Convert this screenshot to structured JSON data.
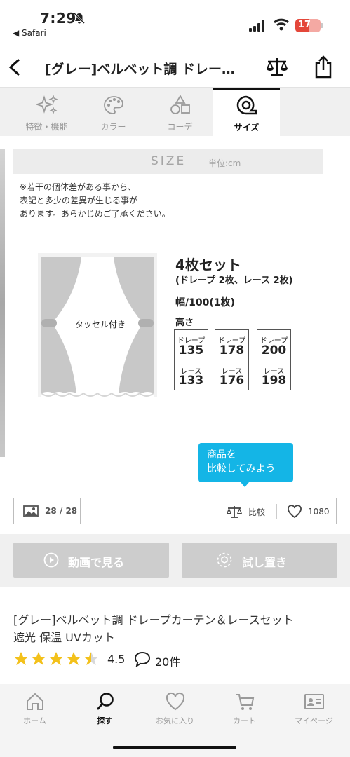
{
  "status_bar": {
    "time": "7:29",
    "back_app": "◀ Safari",
    "battery": "17"
  },
  "header": {
    "title": "[グレー]ベルベット調 ドレー…"
  },
  "tabs": [
    {
      "label": "特徴・機能",
      "icon": "sparkle-icon",
      "active": false
    },
    {
      "label": "カラー",
      "icon": "palette-icon",
      "active": false
    },
    {
      "label": "コーデ",
      "icon": "shapes-icon",
      "active": false
    },
    {
      "label": "サイズ",
      "icon": "tape-measure-icon",
      "active": true
    }
  ],
  "size_section": {
    "heading": "SIZE",
    "unit": "単位:cm",
    "note": [
      "※若干の個体差がある事から、",
      "表記と多少の差異が生じる事が",
      "あります。あらかじめご了承ください。"
    ],
    "tassel_label": "タッセル付き",
    "set_title": "4枚セット",
    "set_sub": "(ドレープ 2枚、レース 2枚)",
    "width": "幅/100(1枚)",
    "height_label": "高さ",
    "heights": [
      {
        "drape_label": "ドレープ",
        "drape": "135",
        "lace_label": "レース",
        "lace": "133"
      },
      {
        "drape_label": "ドレープ",
        "drape": "178",
        "lace_label": "レース",
        "lace": "176"
      },
      {
        "drape_label": "ドレープ",
        "drape": "200",
        "lace_label": "レース",
        "lace": "198"
      }
    ]
  },
  "tooltip": {
    "line1": "商品を",
    "line2": "比較してみよう"
  },
  "gallery": {
    "count": "28 / 28"
  },
  "compare": {
    "label": "比較"
  },
  "favorite": {
    "count": "1080"
  },
  "actions": {
    "video": "動画で見る",
    "try": "試し置き"
  },
  "product": {
    "title_line1": "[グレー]ベルベット調 ドレープカーテン＆レースセット",
    "title_line2": "遮光 保温 UVカット",
    "rating": "4.5",
    "rating_value": 4.5,
    "reviews": "20件"
  },
  "bottom_nav": [
    {
      "label": "ホーム",
      "icon": "home-icon",
      "active": false
    },
    {
      "label": "探す",
      "icon": "search-icon",
      "active": true
    },
    {
      "label": "お気に入り",
      "icon": "heart-icon",
      "active": false
    },
    {
      "label": "カート",
      "icon": "cart-icon",
      "active": false
    },
    {
      "label": "マイページ",
      "icon": "id-card-icon",
      "active": false
    }
  ],
  "colors": {
    "accent": "#14b5e6",
    "star": "#f3c11b",
    "disabled_button": "#cdcdcd"
  }
}
